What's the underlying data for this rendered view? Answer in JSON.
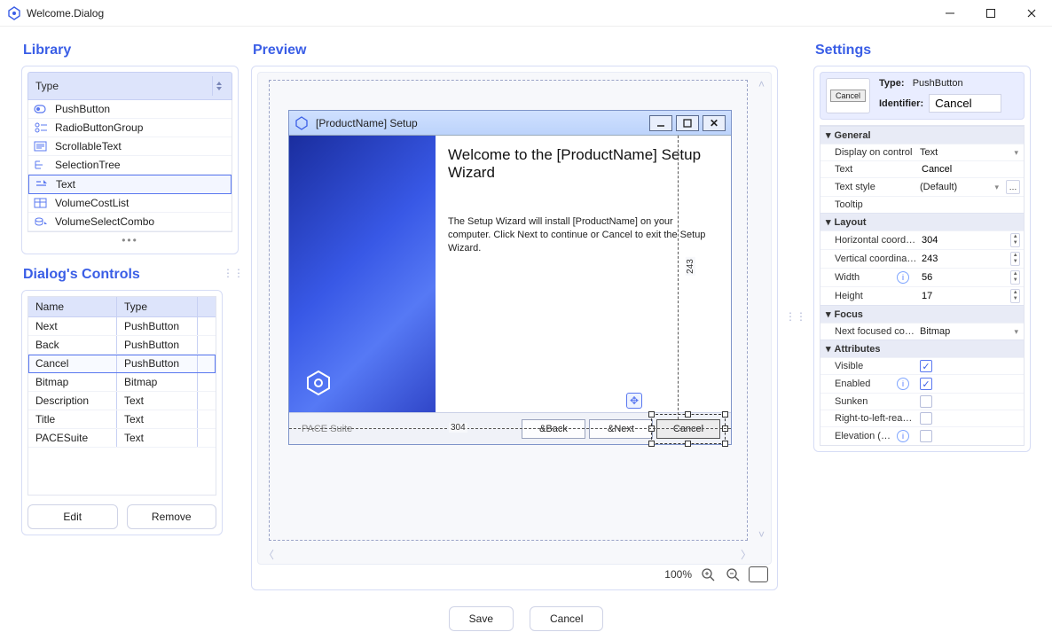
{
  "window": {
    "title": "Welcome.Dialog"
  },
  "sections": {
    "library": "Library",
    "preview": "Preview",
    "controls": "Dialog's Controls",
    "settings": "Settings"
  },
  "library": {
    "header": "Type",
    "items": [
      {
        "label": "PushButton"
      },
      {
        "label": "RadioButtonGroup"
      },
      {
        "label": "ScrollableText"
      },
      {
        "label": "SelectionTree"
      },
      {
        "label": "Text",
        "selected": true
      },
      {
        "label": "VolumeCostList"
      },
      {
        "label": "VolumeSelectCombo"
      }
    ]
  },
  "controls": {
    "headers": {
      "name": "Name",
      "type": "Type"
    },
    "rows": [
      {
        "name": "Next",
        "type": "PushButton"
      },
      {
        "name": "Back",
        "type": "PushButton"
      },
      {
        "name": "Cancel",
        "type": "PushButton",
        "selected": true
      },
      {
        "name": "Bitmap",
        "type": "Bitmap"
      },
      {
        "name": "Description",
        "type": "Text"
      },
      {
        "name": "Title",
        "type": "Text"
      },
      {
        "name": "PACESuite",
        "type": "Text"
      }
    ],
    "buttons": {
      "edit": "Edit",
      "remove": "Remove"
    }
  },
  "preview": {
    "dialog_title": "[ProductName] Setup",
    "heading": "Welcome to the [ProductName] Setup Wizard",
    "paragraph": "The Setup Wizard will install [ProductName] on your computer. Click Next to continue or Cancel to exit the Setup Wizard.",
    "footer_brand": "PACE Suite",
    "buttons": {
      "back": "&Back",
      "next": "&Next",
      "cancel": "Cancel"
    },
    "rulers": {
      "x": "304",
      "y": "243"
    },
    "zoom": "100%"
  },
  "settings": {
    "summary": {
      "type_k": "Type:",
      "type_v": "PushButton",
      "id_k": "Identifier:",
      "id_v": "Cancel"
    },
    "cats": {
      "general": "General",
      "layout": "Layout",
      "focus": "Focus",
      "attributes": "Attributes"
    },
    "general": {
      "display_on_control_k": "Display on control",
      "display_on_control_v": "Text",
      "text_k": "Text",
      "text_v": "Cancel",
      "text_style_k": "Text style",
      "text_style_v": "(Default)",
      "tooltip_k": "Tooltip",
      "tooltip_v": ""
    },
    "layout": {
      "hcoord_k": "Horizontal coord…",
      "hcoord_v": "304",
      "vcoord_k": "Vertical coordina…",
      "vcoord_v": "243",
      "width_k": "Width",
      "width_v": "56",
      "height_k": "Height",
      "height_v": "17"
    },
    "focus": {
      "next_k": "Next focused co…",
      "next_v": "Bitmap"
    },
    "attributes": {
      "visible_k": "Visible",
      "visible_v": true,
      "enabled_k": "Enabled",
      "enabled_v": true,
      "sunken_k": "Sunken",
      "sunken_v": false,
      "rtl_k": "Right-to-left-rea…",
      "rtl_v": false,
      "elev_k": "Elevation (…",
      "elev_v": false
    }
  },
  "actions": {
    "save": "Save",
    "cancel": "Cancel"
  }
}
